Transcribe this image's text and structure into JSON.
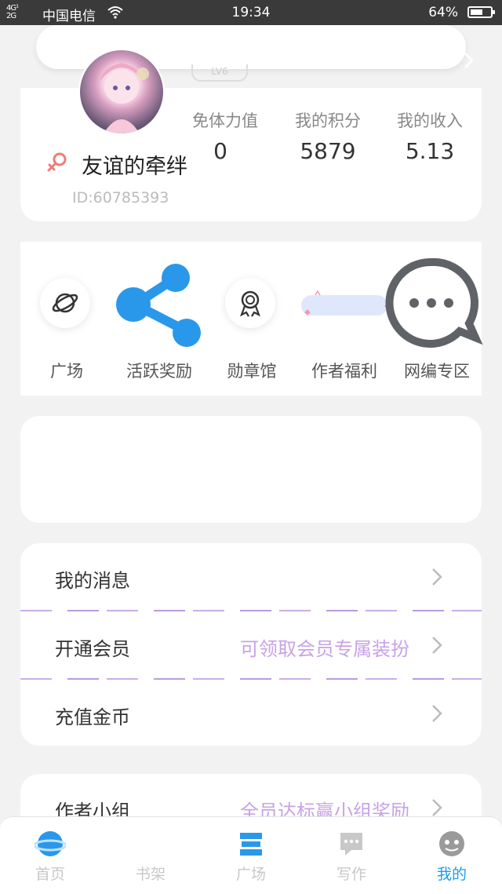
{
  "statusbar": {
    "signal": "4G¹\n2G",
    "carrier": "中国电信",
    "time": "19:34",
    "battery": "64%",
    "battery_level": 0.64
  },
  "profile": {
    "level": "LV6",
    "username": "友谊的牵绊",
    "id": "ID:60785393",
    "stats": [
      {
        "label": "免体力值",
        "value": "0"
      },
      {
        "label": "我的积分",
        "value": "5879"
      },
      {
        "label": "我的收入",
        "value": "5.13"
      }
    ]
  },
  "shortcuts": [
    {
      "label": "广场",
      "icon": "planet-icon"
    },
    {
      "label": "活跃奖励",
      "icon": "share-icon"
    },
    {
      "label": "勋章馆",
      "icon": "medal-icon"
    },
    {
      "label": "作者福利",
      "icon": "ribbon-icon"
    },
    {
      "label": "网编专区",
      "icon": "chat-bubble-icon"
    }
  ],
  "menu": [
    {
      "label": "我的消息",
      "hint": ""
    },
    {
      "label": "开通会员",
      "hint": "可领取会员专属装扮"
    },
    {
      "label": "充值金币",
      "hint": ""
    }
  ],
  "group": {
    "label": "作者小组",
    "hint": "全员达标赢小组奖励"
  },
  "tabbar": {
    "tabs": [
      {
        "label": "首页",
        "icon": "planet-home-icon"
      },
      {
        "label": "书架",
        "icon": "bookshelf-icon"
      },
      {
        "label": "广场",
        "icon": "square-icon"
      },
      {
        "label": "写作",
        "icon": "write-icon"
      },
      {
        "label": "我的",
        "icon": "profile-icon"
      }
    ],
    "active": "我的",
    "active_color": "#1c9cf0"
  },
  "colors": {
    "accent": "#1c9cf0",
    "hint_purple": "#c9a2e6",
    "gender_pink": "#f07b7b"
  }
}
